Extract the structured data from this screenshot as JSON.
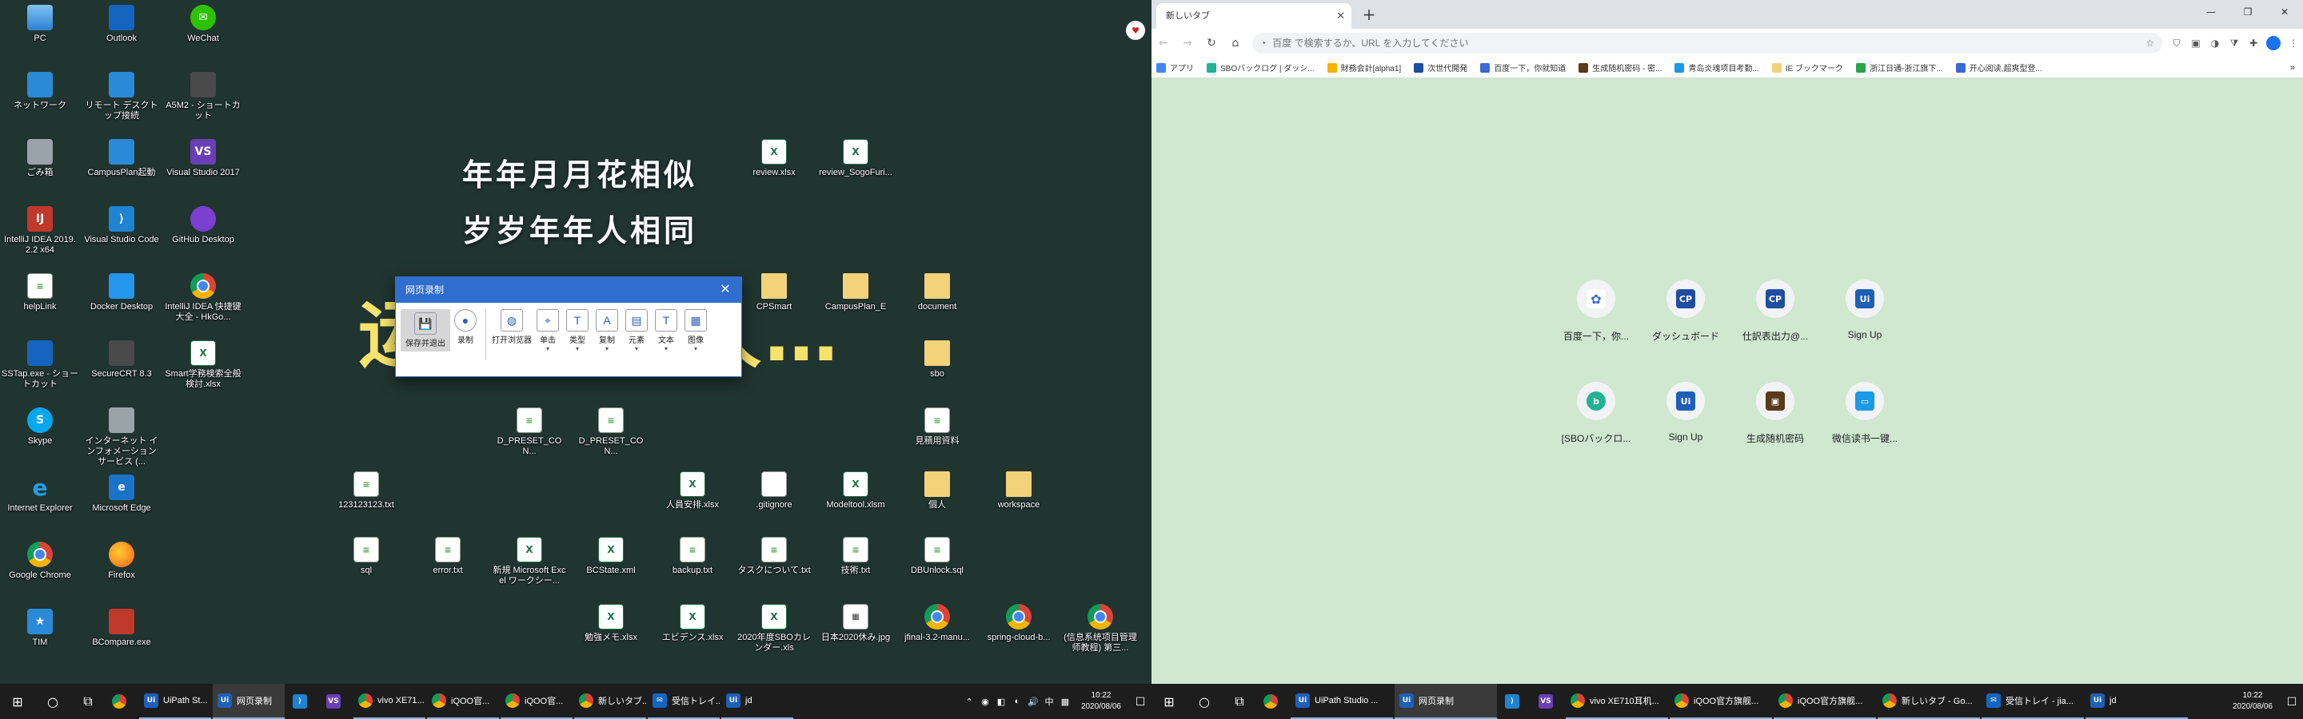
{
  "desktop_left": {
    "poem_line1": "年年月月花相似",
    "poem_line2": "岁岁年年人相同",
    "big_word_left": "运",
    "big_word_right": "久…",
    "icons": [
      {
        "label": "PC",
        "icon": "pc-icon"
      },
      {
        "label": "Outlook",
        "icon": "outlook-icon"
      },
      {
        "label": "WeChat",
        "icon": "wechat-icon"
      },
      {
        "label": "ネットワーク",
        "icon": "network-icon"
      },
      {
        "label": "リモート デスクトップ接続",
        "icon": "remote-desktop-icon"
      },
      {
        "label": "A5M2 - ショートカット",
        "icon": "a5m2-icon"
      },
      {
        "label": "ごみ箱",
        "icon": "recycle-bin-icon"
      },
      {
        "label": "CampusPlan起動",
        "icon": "campusplan-icon"
      },
      {
        "label": "Visual Studio 2017",
        "icon": "visual-studio-icon"
      },
      {
        "label": "IntelliJ IDEA 2019.2.2 x64",
        "icon": "intellij-icon"
      },
      {
        "label": "Visual Studio Code",
        "icon": "vscode-icon"
      },
      {
        "label": "GitHub Desktop",
        "icon": "github-desktop-icon"
      },
      {
        "label": "helpLink",
        "icon": "txt-file-icon"
      },
      {
        "label": "Docker Desktop",
        "icon": "docker-icon"
      },
      {
        "label": "IntelliJ IDEA 快捷键大全 - HkGo...",
        "icon": "chrome-file-icon"
      },
      {
        "label": "SSTap.exe - ショートカット",
        "icon": "sstap-icon"
      },
      {
        "label": "SecureCRT 8.3",
        "icon": "securecrt-icon"
      },
      {
        "label": "Smart学務検索全般検討.xlsx",
        "icon": "excel-file-icon"
      },
      {
        "label": "Skype",
        "icon": "skype-icon"
      },
      {
        "label": "インターネット インフォメーション サービス (...",
        "icon": "iis-icon"
      },
      {
        "label": "Internet Explorer",
        "icon": "ie-icon"
      },
      {
        "label": "Microsoft Edge",
        "icon": "edge-icon"
      },
      {
        "label": "Google Chrome",
        "icon": "chrome-icon"
      },
      {
        "label": "Firefox",
        "icon": "firefox-icon"
      },
      {
        "label": "TIM",
        "icon": "tim-icon"
      },
      {
        "label": "BCompare.exe",
        "icon": "bcompare-icon"
      },
      {
        "label": "123123123.txt",
        "icon": "txt-file-icon"
      },
      {
        "label": "sql",
        "icon": "txt-file-icon"
      },
      {
        "label": "error.txt",
        "icon": "txt-file-icon"
      },
      {
        "label": "新規 Microsoft Excel ワークシー...",
        "icon": "excel-file-icon"
      },
      {
        "label": "D_PRESET_CON...",
        "icon": "txt-file-icon"
      },
      {
        "label": "D_PRESET_CON...",
        "icon": "txt-file-icon"
      },
      {
        "label": "BCState.xml",
        "icon": "excel-file-icon"
      },
      {
        "label": "勉強メモ.xlsx",
        "icon": "excel-file-icon"
      },
      {
        "label": "review.xlsx",
        "icon": "excel-file-icon"
      },
      {
        "label": "review_SogoFuri...",
        "icon": "excel-file-icon"
      },
      {
        "label": "CPSmart",
        "icon": "folder-icon"
      },
      {
        "label": "CampusPlan_E",
        "icon": "folder-icon"
      },
      {
        "label": "document",
        "icon": "folder-icon"
      },
      {
        "label": "sbo",
        "icon": "folder-icon"
      },
      {
        "label": "見積用資料",
        "icon": "txt-file-icon"
      },
      {
        "label": "人員安排.xlsx",
        "icon": "excel-file-icon"
      },
      {
        "label": ".gitignore",
        "icon": "blank-file-icon"
      },
      {
        "label": "Modeltool.xlsm",
        "icon": "excel-file-icon"
      },
      {
        "label": "個人",
        "icon": "folder-icon"
      },
      {
        "label": "workspace",
        "icon": "folder-icon"
      },
      {
        "label": "backup.txt",
        "icon": "txt-file-icon"
      },
      {
        "label": "タスクについて.txt",
        "icon": "txt-file-icon"
      },
      {
        "label": "技術.txt",
        "icon": "txt-file-icon"
      },
      {
        "label": "DBUnlock.sql",
        "icon": "txt-file-icon"
      },
      {
        "label": "エビデンス.xlsx",
        "icon": "excel-file-icon"
      },
      {
        "label": "2020年度SBOカレンダー.xls",
        "icon": "excel-file-icon"
      },
      {
        "label": "日本2020休み.jpg",
        "icon": "calendar-image-icon"
      },
      {
        "label": "jfinal-3.2-manu...",
        "icon": "chrome-file-icon"
      },
      {
        "label": "spring-cloud-b...",
        "icon": "chrome-file-icon"
      },
      {
        "label": "(信息系统项目管理师教程) 第三...",
        "icon": "chrome-file-icon"
      }
    ]
  },
  "recorder": {
    "title": "网页录制",
    "close_icon": "close-icon",
    "save_exit": "保存并退出",
    "record": "录制",
    "open_browser": "打开浏览器",
    "click": "单击",
    "type": "类型",
    "copy": "复制",
    "element": "元素",
    "text": "文本",
    "image": "图像"
  },
  "taskbar_left": {
    "apps": [
      {
        "label": "UiPath St...",
        "icon": "uipath-icon"
      },
      {
        "label": "网页录制",
        "icon": "uipath-icon",
        "active": true
      },
      {
        "label": "",
        "icon": "vscode-icon"
      },
      {
        "label": "",
        "icon": "visual-studio-icon"
      },
      {
        "label": "vivo XE71...",
        "icon": "chrome-icon"
      },
      {
        "label": "iQOO官...",
        "icon": "chrome-icon"
      },
      {
        "label": "iQOO官...",
        "icon": "chrome-icon"
      },
      {
        "label": "新しいタブ...",
        "icon": "chrome-icon"
      },
      {
        "label": "受信トレイ...",
        "icon": "mail-icon"
      },
      {
        "label": "jd",
        "icon": "uipath-icon"
      }
    ],
    "ime": "中",
    "time": "10:22",
    "date": "2020/08/06"
  },
  "chrome": {
    "tab_title": "新しいタブ",
    "search_placeholder": "百度 で検索するか、URL を入力してください",
    "bookmarks": [
      {
        "label": "アプリ",
        "color": "#4285f4"
      },
      {
        "label": "SBOバックログ | ダッシ...",
        "color": "#25b195"
      },
      {
        "label": "財務会計[alpha1]",
        "color": "#f4b400"
      },
      {
        "label": "次世代開発",
        "color": "#1e4da2"
      },
      {
        "label": "百度一下，你就知道",
        "color": "#3a69d3"
      },
      {
        "label": "生成随机密码 - 密...",
        "color": "#5a3a1a"
      },
      {
        "label": "青岛炎魂项目考勤...",
        "color": "#1a9ae8"
      },
      {
        "label": "IE ブックマーク",
        "color": "#f4d27a"
      },
      {
        "label": "浙江日通-浙江旗下...",
        "color": "#2aa54a"
      },
      {
        "label": "开心阅读,超爽型登...",
        "color": "#3a69d3"
      }
    ],
    "shortcuts": [
      {
        "label": "百度一下，你...",
        "icon": "baidu-paw-icon"
      },
      {
        "label": "ダッシュボード",
        "icon": "cp-icon"
      },
      {
        "label": "仕訳表出力@...",
        "icon": "cp-icon"
      },
      {
        "label": "Sign Up",
        "icon": "uipath-icon"
      },
      {
        "label": "[SBOバックロ...",
        "icon": "backlog-icon"
      },
      {
        "label": "Sign Up",
        "icon": "uipath-icon"
      },
      {
        "label": "生成随机密码",
        "icon": "password-gen-icon"
      },
      {
        "label": "微信读书一键...",
        "icon": "weread-icon"
      }
    ]
  },
  "taskbar_right": {
    "apps": [
      {
        "label": "UiPath Studio ...",
        "icon": "uipath-icon"
      },
      {
        "label": "网页录制",
        "icon": "uipath-icon",
        "active": true
      },
      {
        "label": "",
        "icon": "vscode-icon"
      },
      {
        "label": "",
        "icon": "visual-studio-icon"
      },
      {
        "label": "vivo XE710耳机...",
        "icon": "chrome-icon"
      },
      {
        "label": "iQOO官方旗舰...",
        "icon": "chrome-icon"
      },
      {
        "label": "iQOO官方旗舰...",
        "icon": "chrome-icon"
      },
      {
        "label": "新しいタブ - Go...",
        "icon": "chrome-icon"
      },
      {
        "label": "受信トレイ - jia...",
        "icon": "mail-icon"
      },
      {
        "label": "jd",
        "icon": "uipath-icon"
      }
    ],
    "time": "10:22",
    "date": "2020/08/06"
  }
}
